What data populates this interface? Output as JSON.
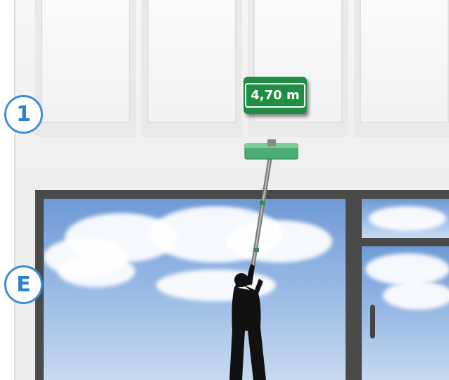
{
  "floor_labels": {
    "first_floor": "1",
    "ground_floor": "E"
  },
  "height_sign": {
    "value": "4,70 m"
  },
  "colors": {
    "badge_blue": "#3a8fd8",
    "sign_green": "#1f8e44",
    "squeegee_green": "#4caf72",
    "frame_dark": "#4a4a4a",
    "silhouette": "#111111"
  },
  "icons": {
    "worker": "person-silhouette-icon",
    "tool": "telescopic-pole-squeegee-icon"
  }
}
